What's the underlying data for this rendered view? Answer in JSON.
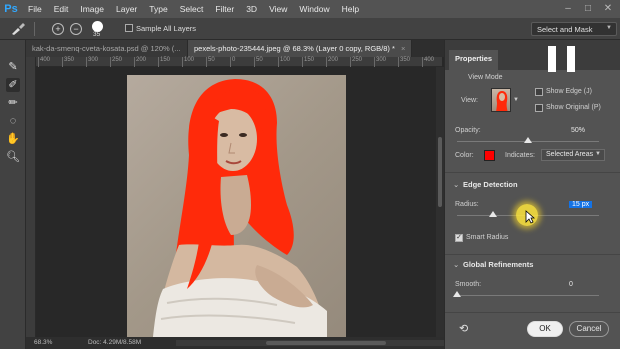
{
  "app": {
    "logo": "Ps"
  },
  "menu": [
    "File",
    "Edit",
    "Image",
    "Layer",
    "Type",
    "Select",
    "Filter",
    "3D",
    "View",
    "Window",
    "Help"
  ],
  "options": {
    "brush_size": "35",
    "sample_all_layers": "Sample All Layers",
    "select_and_mask": "Select and Mask",
    "plus_icon": "plus-circle-icon",
    "minus_icon": "minus-circle-icon"
  },
  "tabs": [
    {
      "label": "kak-da-smenq-cveta-kosata.psd @ 120% (...",
      "active": false
    },
    {
      "label": "pexels-photo-235444.jpeg @ 68.3% (Layer 0 copy, RGB/8) *",
      "active": true
    }
  ],
  "ruler": [
    "400",
    "350",
    "300",
    "250",
    "200",
    "150",
    "100",
    "50",
    "0",
    "50",
    "100",
    "150",
    "200",
    "250",
    "300",
    "350",
    "400"
  ],
  "status": {
    "zoom": "68.3%",
    "doc": "Doc: 4.29M/8.58M"
  },
  "properties": {
    "tab_label": "Properties",
    "view_mode": {
      "title": "View Mode",
      "view_label": "View:",
      "show_edge": "Show Edge (J)",
      "show_original": "Show Original (P)"
    },
    "opacity": {
      "label": "Opacity:",
      "value": "50%",
      "fraction": 0.5
    },
    "color": {
      "label": "Color:",
      "swatch": "#ff0000"
    },
    "indicates": {
      "label": "Indicates:",
      "value": "Selected Areas"
    },
    "edge_detection": {
      "title": "Edge Detection",
      "radius_label": "Radius:",
      "radius_value": "15 px",
      "radius_fraction": 0.25,
      "smart_radius": "Smart Radius"
    },
    "global_refinements": {
      "title": "Global Refinements",
      "smooth_label": "Smooth:",
      "smooth_value": "0",
      "smooth_fraction": 0.0
    },
    "ok": "OK",
    "cancel": "Cancel"
  },
  "colors": {
    "accent": "#1473e6",
    "hair": "#ff2a0a"
  }
}
